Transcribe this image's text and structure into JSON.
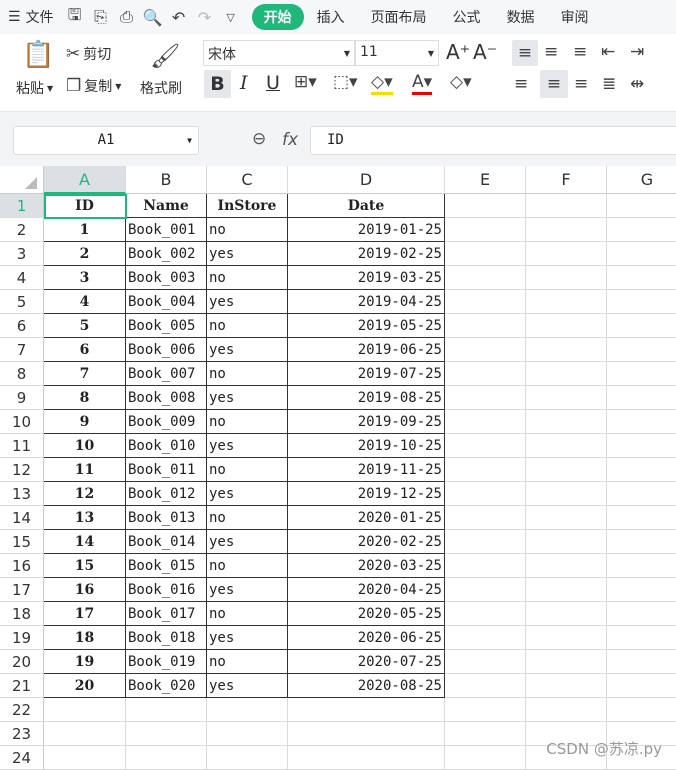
{
  "menu": {
    "file": "文件",
    "tabs": [
      "开始",
      "插入",
      "页面布局",
      "公式",
      "数据",
      "审阅"
    ]
  },
  "ribbon": {
    "paste": "粘贴",
    "cut": "剪切",
    "copy": "复制",
    "format_painter": "格式刷",
    "font": "宋体",
    "font_size": "11",
    "bold": "B",
    "italic": "I",
    "underline": "U"
  },
  "formula_bar": {
    "cell_ref": "A1",
    "fx": "fx",
    "value": "ID"
  },
  "columns": [
    "A",
    "B",
    "C",
    "D",
    "E",
    "F",
    "G"
  ],
  "headers": [
    "ID",
    "Name",
    "InStore",
    "Date"
  ],
  "rows": [
    [
      "1",
      "Book_001",
      "no",
      "2019-01-25"
    ],
    [
      "2",
      "Book_002",
      "yes",
      "2019-02-25"
    ],
    [
      "3",
      "Book_003",
      "no",
      "2019-03-25"
    ],
    [
      "4",
      "Book_004",
      "yes",
      "2019-04-25"
    ],
    [
      "5",
      "Book_005",
      "no",
      "2019-05-25"
    ],
    [
      "6",
      "Book_006",
      "yes",
      "2019-06-25"
    ],
    [
      "7",
      "Book_007",
      "no",
      "2019-07-25"
    ],
    [
      "8",
      "Book_008",
      "yes",
      "2019-08-25"
    ],
    [
      "9",
      "Book_009",
      "no",
      "2019-09-25"
    ],
    [
      "10",
      "Book_010",
      "yes",
      "2019-10-25"
    ],
    [
      "11",
      "Book_011",
      "no",
      "2019-11-25"
    ],
    [
      "12",
      "Book_012",
      "yes",
      "2019-12-25"
    ],
    [
      "13",
      "Book_013",
      "no",
      "2020-01-25"
    ],
    [
      "14",
      "Book_014",
      "yes",
      "2020-02-25"
    ],
    [
      "15",
      "Book_015",
      "no",
      "2020-03-25"
    ],
    [
      "16",
      "Book_016",
      "yes",
      "2020-04-25"
    ],
    [
      "17",
      "Book_017",
      "no",
      "2020-05-25"
    ],
    [
      "18",
      "Book_018",
      "yes",
      "2020-06-25"
    ],
    [
      "19",
      "Book_019",
      "no",
      "2020-07-25"
    ],
    [
      "20",
      "Book_020",
      "yes",
      "2020-08-25"
    ]
  ],
  "row_numbers": [
    "1",
    "2",
    "3",
    "4",
    "5",
    "6",
    "7",
    "8",
    "9",
    "10",
    "11",
    "12",
    "13",
    "14",
    "15",
    "16",
    "17",
    "18",
    "19",
    "20",
    "21",
    "22",
    "23",
    "24"
  ],
  "watermark": "CSDN @苏凉.py",
  "accent": "#1fb77a"
}
